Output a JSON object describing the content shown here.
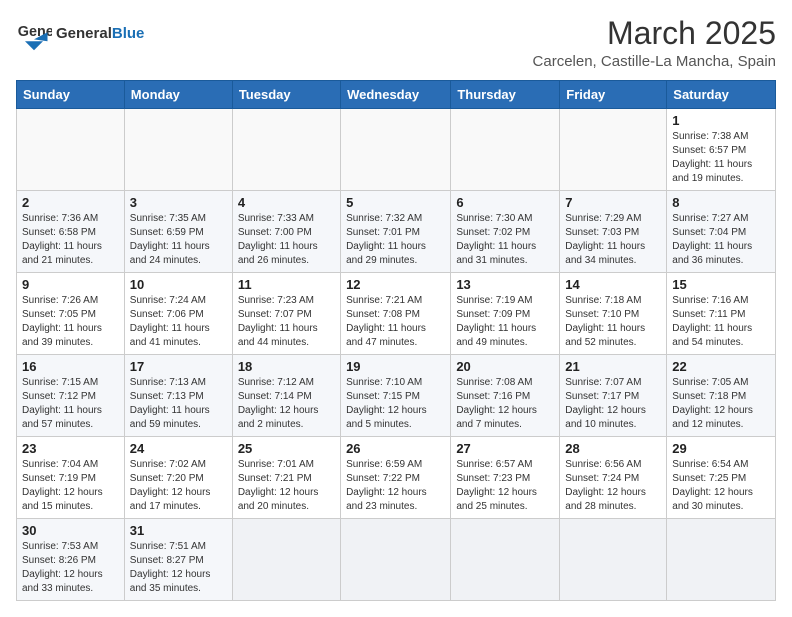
{
  "header": {
    "logo_general": "General",
    "logo_blue": "Blue",
    "month": "March 2025",
    "location": "Carcelen, Castille-La Mancha, Spain"
  },
  "weekdays": [
    "Sunday",
    "Monday",
    "Tuesday",
    "Wednesday",
    "Thursday",
    "Friday",
    "Saturday"
  ],
  "weeks": [
    [
      {
        "day": "",
        "info": ""
      },
      {
        "day": "",
        "info": ""
      },
      {
        "day": "",
        "info": ""
      },
      {
        "day": "",
        "info": ""
      },
      {
        "day": "",
        "info": ""
      },
      {
        "day": "",
        "info": ""
      },
      {
        "day": "1",
        "info": "Sunrise: 7:38 AM\nSunset: 6:57 PM\nDaylight: 11 hours and 19 minutes."
      }
    ],
    [
      {
        "day": "2",
        "info": "Sunrise: 7:36 AM\nSunset: 6:58 PM\nDaylight: 11 hours and 21 minutes."
      },
      {
        "day": "3",
        "info": "Sunrise: 7:35 AM\nSunset: 6:59 PM\nDaylight: 11 hours and 24 minutes."
      },
      {
        "day": "4",
        "info": "Sunrise: 7:33 AM\nSunset: 7:00 PM\nDaylight: 11 hours and 26 minutes."
      },
      {
        "day": "5",
        "info": "Sunrise: 7:32 AM\nSunset: 7:01 PM\nDaylight: 11 hours and 29 minutes."
      },
      {
        "day": "6",
        "info": "Sunrise: 7:30 AM\nSunset: 7:02 PM\nDaylight: 11 hours and 31 minutes."
      },
      {
        "day": "7",
        "info": "Sunrise: 7:29 AM\nSunset: 7:03 PM\nDaylight: 11 hours and 34 minutes."
      },
      {
        "day": "8",
        "info": "Sunrise: 7:27 AM\nSunset: 7:04 PM\nDaylight: 11 hours and 36 minutes."
      }
    ],
    [
      {
        "day": "9",
        "info": "Sunrise: 7:26 AM\nSunset: 7:05 PM\nDaylight: 11 hours and 39 minutes."
      },
      {
        "day": "10",
        "info": "Sunrise: 7:24 AM\nSunset: 7:06 PM\nDaylight: 11 hours and 41 minutes."
      },
      {
        "day": "11",
        "info": "Sunrise: 7:23 AM\nSunset: 7:07 PM\nDaylight: 11 hours and 44 minutes."
      },
      {
        "day": "12",
        "info": "Sunrise: 7:21 AM\nSunset: 7:08 PM\nDaylight: 11 hours and 47 minutes."
      },
      {
        "day": "13",
        "info": "Sunrise: 7:19 AM\nSunset: 7:09 PM\nDaylight: 11 hours and 49 minutes."
      },
      {
        "day": "14",
        "info": "Sunrise: 7:18 AM\nSunset: 7:10 PM\nDaylight: 11 hours and 52 minutes."
      },
      {
        "day": "15",
        "info": "Sunrise: 7:16 AM\nSunset: 7:11 PM\nDaylight: 11 hours and 54 minutes."
      }
    ],
    [
      {
        "day": "16",
        "info": "Sunrise: 7:15 AM\nSunset: 7:12 PM\nDaylight: 11 hours and 57 minutes."
      },
      {
        "day": "17",
        "info": "Sunrise: 7:13 AM\nSunset: 7:13 PM\nDaylight: 11 hours and 59 minutes."
      },
      {
        "day": "18",
        "info": "Sunrise: 7:12 AM\nSunset: 7:14 PM\nDaylight: 12 hours and 2 minutes."
      },
      {
        "day": "19",
        "info": "Sunrise: 7:10 AM\nSunset: 7:15 PM\nDaylight: 12 hours and 5 minutes."
      },
      {
        "day": "20",
        "info": "Sunrise: 7:08 AM\nSunset: 7:16 PM\nDaylight: 12 hours and 7 minutes."
      },
      {
        "day": "21",
        "info": "Sunrise: 7:07 AM\nSunset: 7:17 PM\nDaylight: 12 hours and 10 minutes."
      },
      {
        "day": "22",
        "info": "Sunrise: 7:05 AM\nSunset: 7:18 PM\nDaylight: 12 hours and 12 minutes."
      }
    ],
    [
      {
        "day": "23",
        "info": "Sunrise: 7:04 AM\nSunset: 7:19 PM\nDaylight: 12 hours and 15 minutes."
      },
      {
        "day": "24",
        "info": "Sunrise: 7:02 AM\nSunset: 7:20 PM\nDaylight: 12 hours and 17 minutes."
      },
      {
        "day": "25",
        "info": "Sunrise: 7:01 AM\nSunset: 7:21 PM\nDaylight: 12 hours and 20 minutes."
      },
      {
        "day": "26",
        "info": "Sunrise: 6:59 AM\nSunset: 7:22 PM\nDaylight: 12 hours and 23 minutes."
      },
      {
        "day": "27",
        "info": "Sunrise: 6:57 AM\nSunset: 7:23 PM\nDaylight: 12 hours and 25 minutes."
      },
      {
        "day": "28",
        "info": "Sunrise: 6:56 AM\nSunset: 7:24 PM\nDaylight: 12 hours and 28 minutes."
      },
      {
        "day": "29",
        "info": "Sunrise: 6:54 AM\nSunset: 7:25 PM\nDaylight: 12 hours and 30 minutes."
      }
    ],
    [
      {
        "day": "30",
        "info": "Sunrise: 7:53 AM\nSunset: 8:26 PM\nDaylight: 12 hours and 33 minutes."
      },
      {
        "day": "31",
        "info": "Sunrise: 7:51 AM\nSunset: 8:27 PM\nDaylight: 12 hours and 35 minutes."
      },
      {
        "day": "",
        "info": ""
      },
      {
        "day": "",
        "info": ""
      },
      {
        "day": "",
        "info": ""
      },
      {
        "day": "",
        "info": ""
      },
      {
        "day": "",
        "info": ""
      }
    ]
  ]
}
